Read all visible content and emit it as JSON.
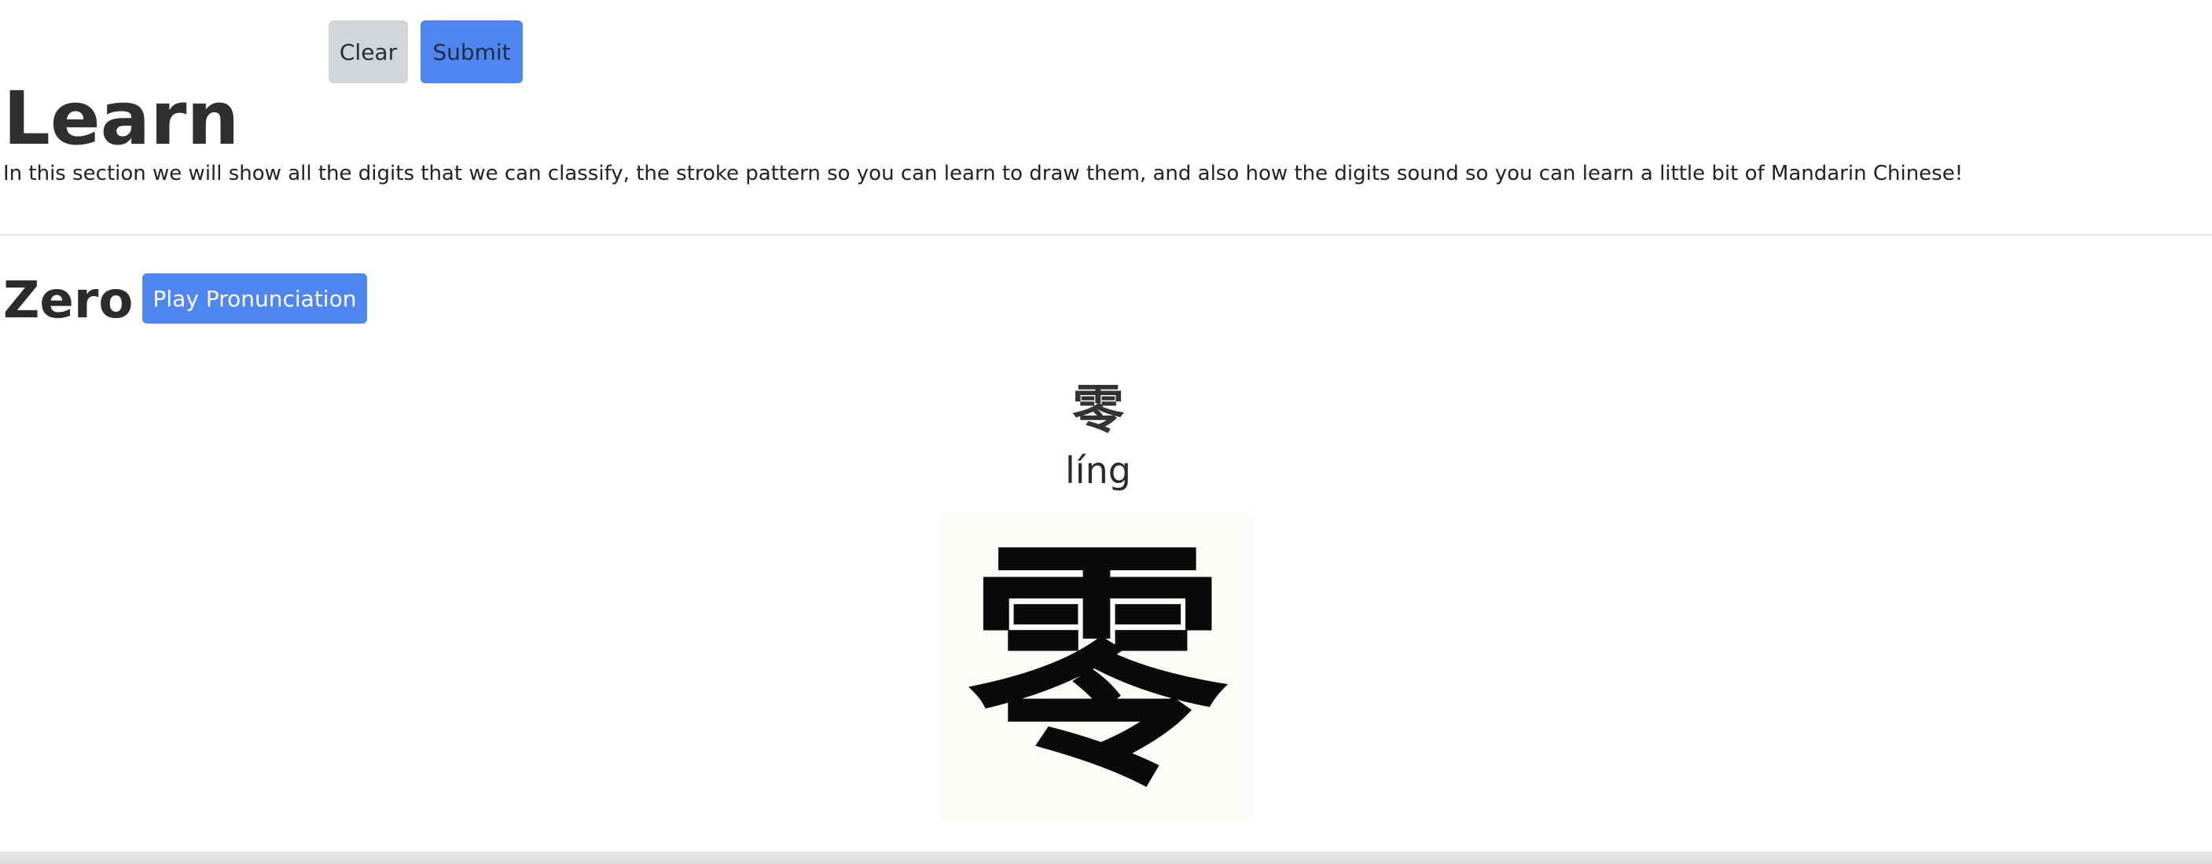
{
  "toolbar": {
    "clear_label": "Clear",
    "submit_label": "Submit"
  },
  "learn": {
    "title": "Learn",
    "intro": "In this section we will show all the digits that we can classify, the stroke pattern so you can learn to draw them, and also how the digits sound so you can learn a little bit of Mandarin Chinese!"
  },
  "digit": {
    "name": "Zero",
    "play_label": "Play Pronunciation",
    "character": "零",
    "pinyin": "líng",
    "stroke_character": "零"
  },
  "colors": {
    "primary": "#4f86ef",
    "secondary": "#d2d6da",
    "text": "#2b2b2b"
  }
}
